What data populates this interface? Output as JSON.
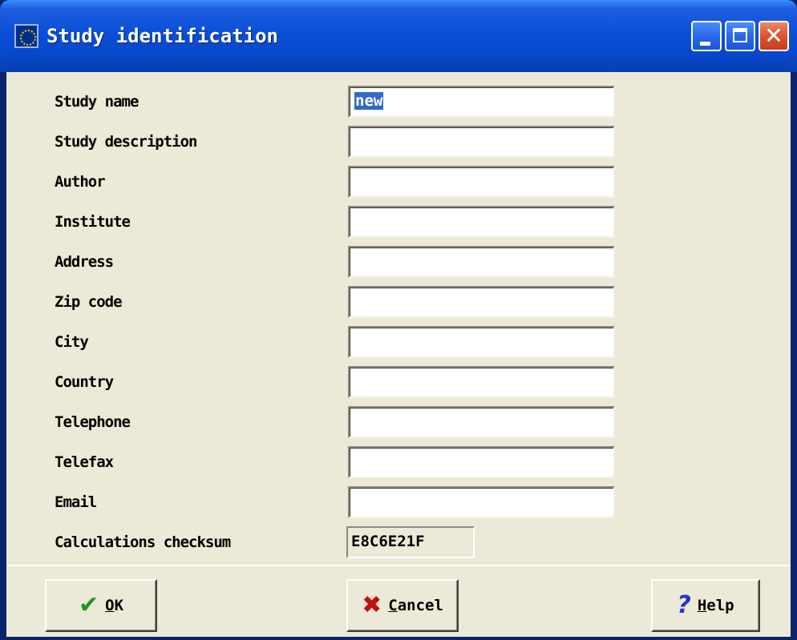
{
  "window": {
    "title": "Study identification"
  },
  "form": {
    "fields": [
      {
        "label": "Study name",
        "value": "new"
      },
      {
        "label": "Study description",
        "value": ""
      },
      {
        "label": "Author",
        "value": ""
      },
      {
        "label": "Institute",
        "value": ""
      },
      {
        "label": "Address",
        "value": ""
      },
      {
        "label": "Zip code",
        "value": ""
      },
      {
        "label": "City",
        "value": ""
      },
      {
        "label": "Country",
        "value": ""
      },
      {
        "label": "Telephone",
        "value": ""
      },
      {
        "label": "Telefax",
        "value": ""
      },
      {
        "label": "Email",
        "value": ""
      }
    ],
    "checksum": {
      "label": "Calculations checksum",
      "value": "E8C6E21F"
    }
  },
  "buttons": {
    "ok": {
      "accel": "O",
      "rest": "K",
      "icon": "checkmark-icon",
      "icon_color": "#1C9A1C"
    },
    "cancel": {
      "accel": "C",
      "rest": "ancel",
      "icon": "red-x-icon",
      "icon_color": "#C01010"
    },
    "help": {
      "accel": "H",
      "rest": "elp",
      "icon": "question-mark-icon",
      "icon_color": "#2036C8"
    }
  },
  "colors": {
    "titlebar": "#0A4FD8",
    "dialog_background": "#ECE9D8",
    "selection": "#316AC5",
    "close_button": "#D9532E"
  }
}
